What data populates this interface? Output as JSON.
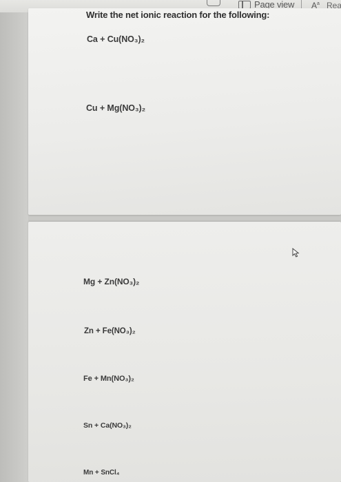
{
  "toolbar": {
    "page_view_label": "Page view",
    "text_size_label": "A",
    "text_size_superscript": "a",
    "reader_label": "Rea"
  },
  "worksheet": {
    "heading": "Write the net ionic reaction for the following:",
    "reactions": [
      "Ca + Cu(NO₃)₂",
      "Cu + Mg(NO₃)₂",
      "Mg + Zn(NO₃)₂",
      "Zn + Fe(NO₃)₂",
      "Fe + Mn(NO₃)₂",
      "Sn + Ca(NO₃)₂",
      "Mn + SnCl₄"
    ]
  },
  "icons": {
    "page_view": "page-view-icon",
    "text_size": "text-size-icon",
    "cursor": "mouse-pointer-icon"
  }
}
